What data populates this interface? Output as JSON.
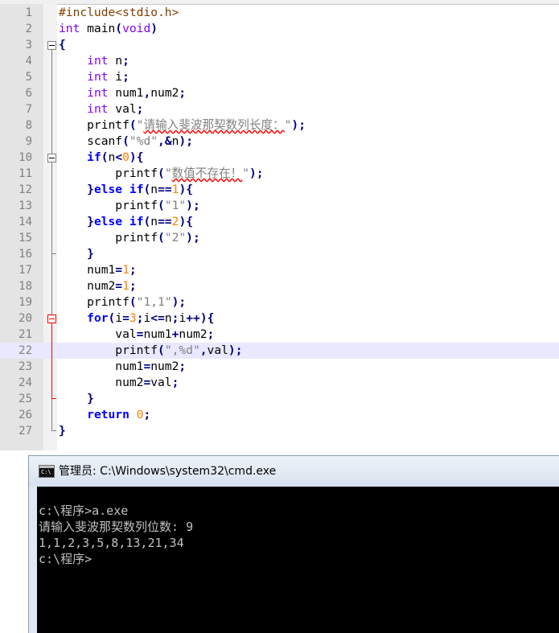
{
  "editor": {
    "lines": [
      {
        "n": "1",
        "t": [
          {
            "c": "pre",
            "s": "#include<stdio.h>"
          }
        ]
      },
      {
        "n": "2",
        "t": [
          {
            "c": "kw-type",
            "s": "int"
          },
          {
            "c": "",
            "s": " main"
          },
          {
            "c": "op",
            "s": "("
          },
          {
            "c": "kw-type",
            "s": "void"
          },
          {
            "c": "op",
            "s": ")"
          }
        ]
      },
      {
        "n": "3",
        "t": [
          {
            "c": "op",
            "s": "{"
          }
        ]
      },
      {
        "n": "4",
        "t": [
          {
            "c": "",
            "s": "    "
          },
          {
            "c": "kw-type",
            "s": "int"
          },
          {
            "c": "",
            "s": " n"
          },
          {
            "c": "op",
            "s": ";"
          }
        ]
      },
      {
        "n": "5",
        "t": [
          {
            "c": "",
            "s": "    "
          },
          {
            "c": "kw-type",
            "s": "int"
          },
          {
            "c": "",
            "s": " i"
          },
          {
            "c": "op",
            "s": ";"
          }
        ]
      },
      {
        "n": "6",
        "t": [
          {
            "c": "",
            "s": "    "
          },
          {
            "c": "kw-type",
            "s": "int"
          },
          {
            "c": "",
            "s": " num1"
          },
          {
            "c": "op",
            "s": ","
          },
          {
            "c": "",
            "s": "num2"
          },
          {
            "c": "op",
            "s": ";"
          }
        ]
      },
      {
        "n": "7",
        "t": [
          {
            "c": "",
            "s": "    "
          },
          {
            "c": "kw-type",
            "s": "int"
          },
          {
            "c": "",
            "s": " val"
          },
          {
            "c": "op",
            "s": ";"
          }
        ]
      },
      {
        "n": "8",
        "t": [
          {
            "c": "",
            "s": "    printf"
          },
          {
            "c": "op",
            "s": "("
          },
          {
            "c": "str",
            "s": "\""
          },
          {
            "c": "str squig",
            "s": "请输入斐波那契数列长度："
          },
          {
            "c": "str",
            "s": "\""
          },
          {
            "c": "op",
            "s": ");"
          }
        ]
      },
      {
        "n": "9",
        "t": [
          {
            "c": "",
            "s": "    scanf"
          },
          {
            "c": "op",
            "s": "("
          },
          {
            "c": "str",
            "s": "\"%d\""
          },
          {
            "c": "op",
            "s": ",&"
          },
          {
            "c": "",
            "s": "n"
          },
          {
            "c": "op",
            "s": ");"
          }
        ]
      },
      {
        "n": "10",
        "t": [
          {
            "c": "",
            "s": "    "
          },
          {
            "c": "kw",
            "s": "if"
          },
          {
            "c": "op",
            "s": "("
          },
          {
            "c": "",
            "s": "n"
          },
          {
            "c": "op",
            "s": "<"
          },
          {
            "c": "num",
            "s": "0"
          },
          {
            "c": "op",
            "s": "){"
          }
        ]
      },
      {
        "n": "11",
        "t": [
          {
            "c": "",
            "s": "        printf"
          },
          {
            "c": "op",
            "s": "("
          },
          {
            "c": "str",
            "s": "\""
          },
          {
            "c": "str squig",
            "s": "数值不存在！"
          },
          {
            "c": "str",
            "s": "\""
          },
          {
            "c": "op",
            "s": ");"
          }
        ]
      },
      {
        "n": "12",
        "t": [
          {
            "c": "",
            "s": "    "
          },
          {
            "c": "op",
            "s": "}"
          },
          {
            "c": "kw",
            "s": "else"
          },
          {
            "c": "",
            "s": " "
          },
          {
            "c": "kw",
            "s": "if"
          },
          {
            "c": "op",
            "s": "("
          },
          {
            "c": "",
            "s": "n"
          },
          {
            "c": "op",
            "s": "=="
          },
          {
            "c": "num",
            "s": "1"
          },
          {
            "c": "op",
            "s": "){"
          }
        ]
      },
      {
        "n": "13",
        "t": [
          {
            "c": "",
            "s": "        printf"
          },
          {
            "c": "op",
            "s": "("
          },
          {
            "c": "str",
            "s": "\"1\""
          },
          {
            "c": "op",
            "s": ");"
          }
        ]
      },
      {
        "n": "14",
        "t": [
          {
            "c": "",
            "s": "    "
          },
          {
            "c": "op",
            "s": "}"
          },
          {
            "c": "kw",
            "s": "else"
          },
          {
            "c": "",
            "s": " "
          },
          {
            "c": "kw",
            "s": "if"
          },
          {
            "c": "op",
            "s": "("
          },
          {
            "c": "",
            "s": "n"
          },
          {
            "c": "op",
            "s": "=="
          },
          {
            "c": "num",
            "s": "2"
          },
          {
            "c": "op",
            "s": "){"
          }
        ]
      },
      {
        "n": "15",
        "t": [
          {
            "c": "",
            "s": "        printf"
          },
          {
            "c": "op",
            "s": "("
          },
          {
            "c": "str",
            "s": "\"2\""
          },
          {
            "c": "op",
            "s": ");"
          }
        ]
      },
      {
        "n": "16",
        "t": [
          {
            "c": "",
            "s": "    "
          },
          {
            "c": "op",
            "s": "}"
          }
        ]
      },
      {
        "n": "17",
        "t": [
          {
            "c": "",
            "s": "    num1"
          },
          {
            "c": "op",
            "s": "="
          },
          {
            "c": "num",
            "s": "1"
          },
          {
            "c": "op",
            "s": ";"
          }
        ]
      },
      {
        "n": "18",
        "t": [
          {
            "c": "",
            "s": "    num2"
          },
          {
            "c": "op",
            "s": "="
          },
          {
            "c": "num",
            "s": "1"
          },
          {
            "c": "op",
            "s": ";"
          }
        ]
      },
      {
        "n": "19",
        "t": [
          {
            "c": "",
            "s": "    printf"
          },
          {
            "c": "op",
            "s": "("
          },
          {
            "c": "str",
            "s": "\"1,1\""
          },
          {
            "c": "op",
            "s": ");"
          }
        ]
      },
      {
        "n": "20",
        "t": [
          {
            "c": "",
            "s": "    "
          },
          {
            "c": "kw",
            "s": "for"
          },
          {
            "c": "op",
            "s": "("
          },
          {
            "c": "",
            "s": "i"
          },
          {
            "c": "op",
            "s": "="
          },
          {
            "c": "num",
            "s": "3"
          },
          {
            "c": "op",
            "s": ";"
          },
          {
            "c": "",
            "s": "i"
          },
          {
            "c": "op",
            "s": "<="
          },
          {
            "c": "",
            "s": "n"
          },
          {
            "c": "op",
            "s": ";"
          },
          {
            "c": "",
            "s": "i"
          },
          {
            "c": "op",
            "s": "++){"
          }
        ]
      },
      {
        "n": "21",
        "t": [
          {
            "c": "",
            "s": "        val"
          },
          {
            "c": "op",
            "s": "="
          },
          {
            "c": "",
            "s": "num1"
          },
          {
            "c": "op",
            "s": "+"
          },
          {
            "c": "",
            "s": "num2"
          },
          {
            "c": "op",
            "s": ";"
          }
        ]
      },
      {
        "n": "22",
        "t": [
          {
            "c": "",
            "s": "        printf"
          },
          {
            "c": "op",
            "s": "("
          },
          {
            "c": "str",
            "s": "\",%d\""
          },
          {
            "c": "op",
            "s": ","
          },
          {
            "c": "",
            "s": "val"
          },
          {
            "c": "op",
            "s": ");"
          }
        ]
      },
      {
        "n": "23",
        "t": [
          {
            "c": "",
            "s": "        num1"
          },
          {
            "c": "op",
            "s": "="
          },
          {
            "c": "",
            "s": "num2"
          },
          {
            "c": "op",
            "s": ";"
          }
        ]
      },
      {
        "n": "24",
        "t": [
          {
            "c": "",
            "s": "        num2"
          },
          {
            "c": "op",
            "s": "="
          },
          {
            "c": "",
            "s": "val"
          },
          {
            "c": "op",
            "s": ";"
          }
        ]
      },
      {
        "n": "25",
        "t": [
          {
            "c": "",
            "s": "    "
          },
          {
            "c": "op",
            "s": "}"
          }
        ]
      },
      {
        "n": "26",
        "t": [
          {
            "c": "",
            "s": "    "
          },
          {
            "c": "kw",
            "s": "return"
          },
          {
            "c": "",
            "s": " "
          },
          {
            "c": "num",
            "s": "0"
          },
          {
            "c": "op",
            "s": ";"
          }
        ]
      },
      {
        "n": "27",
        "t": [
          {
            "c": "op",
            "s": "}"
          }
        ]
      }
    ]
  },
  "cmd": {
    "title": "管理员: C:\\Windows\\system32\\cmd.exe",
    "icon_text": "C:\\",
    "lines": [
      "c:\\程序>a.exe",
      "请输入斐波那契数列位数: 9",
      "1,1,2,3,5,8,13,21,34",
      "c:\\程序>"
    ]
  }
}
